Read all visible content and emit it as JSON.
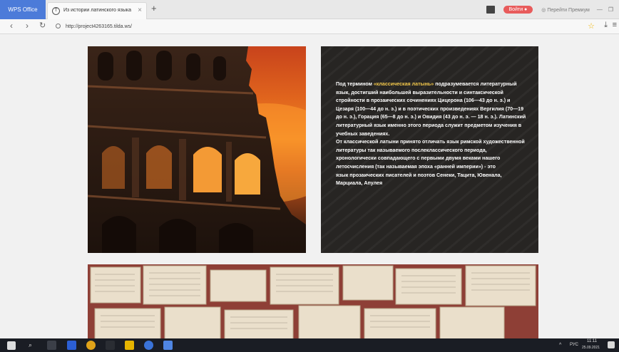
{
  "browser": {
    "wps_tab_label": "WPS Office",
    "tab_title": "Из истории латинского языка",
    "tab_close": "×",
    "new_tab": "+",
    "login_label": "Войти",
    "premium_label": "Перейти Премиум",
    "url": "http://project4263165.tilda.ws/"
  },
  "article": {
    "paragraph_1_lead": "Под термином ",
    "highlight": "«классическая латынь»",
    "paragraph_1_rest": " подразумевается литературный язык, достигший наибольшей выразительности и синтаксической стройности в прозаических сочинениях Цицерона (106—43 до н. э.) и Цезаря (100—44 до н. э.) и в поэтических произведениях Вергилия (70—19 до н. э.), Горация (65—8 до н. э.) и Овидия (43 до н. э. — 18 н. э.). Латинский литературный язык именно этого периода служит предметом изучения в учебных заведениях.",
    "paragraph_2": "От классической латыни принято отличать язык римской художественной литературы так называемого послеклассического периода, хронологически совпадающего с первыми двумя веками нашего летосчисления (так называемая эпоха «ранней империи») - это",
    "paragraph_3": "язык прозаических писателей и поэтов Сенеки, Тацита, Ювенала, Марциала, Апулея"
  },
  "taskbar": {
    "lang": "РУС",
    "time": "11:11",
    "date": "25.09.2021"
  },
  "colors": {
    "wps_blue": "#4c7bd9",
    "login_red": "#e85b5b",
    "text_panel": "#272523",
    "highlight_yellow": "#f3c84b"
  }
}
